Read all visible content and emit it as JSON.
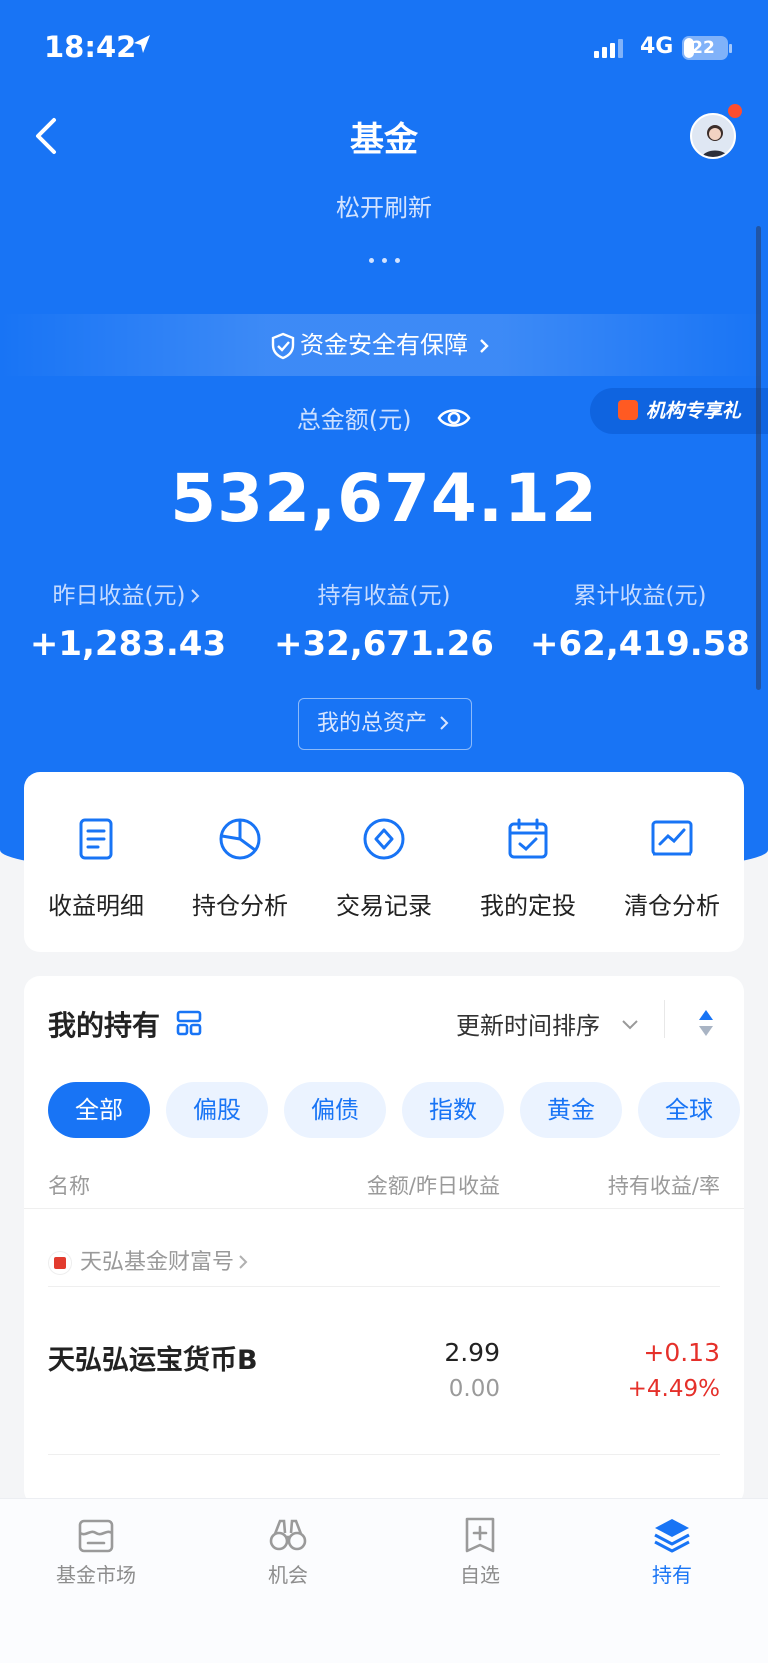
{
  "status_bar": {
    "time": "18:42",
    "network": "4G",
    "battery": "22"
  },
  "header": {
    "title": "基金"
  },
  "pull_refresh": {
    "text": "松开刷新"
  },
  "security": {
    "text": "资金安全有保障"
  },
  "promo": {
    "label": "机构专享礼"
  },
  "summary": {
    "total_label": "总金额(元)",
    "total_value": "532,674.12",
    "stats": [
      {
        "label": "昨日收益(元)",
        "value": "+1,283.43"
      },
      {
        "label": "持有收益(元)",
        "value": "+32,671.26"
      },
      {
        "label": "累计收益(元)",
        "value": "+62,419.58"
      }
    ],
    "assets_button": "我的总资产"
  },
  "quick_actions": [
    {
      "label": "收益明细",
      "icon": "document-icon"
    },
    {
      "label": "持仓分析",
      "icon": "pie-chart-icon"
    },
    {
      "label": "交易记录",
      "icon": "compass-icon"
    },
    {
      "label": "我的定投",
      "icon": "calendar-check-icon"
    },
    {
      "label": "清仓分析",
      "icon": "trend-chart-icon"
    }
  ],
  "holdings": {
    "title": "我的持有",
    "sort_label": "更新时间排序",
    "filters": [
      "全部",
      "偏股",
      "偏债",
      "指数",
      "黄金",
      "全球"
    ],
    "active_filter": "全部",
    "columns": {
      "name": "名称",
      "amount": "金额/昨日收益",
      "profit": "持有收益/率"
    },
    "company": "天弘基金财富号",
    "funds": [
      {
        "name": "天弘弘运宝货币B",
        "amount": "2.99",
        "yesterday": "0.00",
        "profit": "+0.13",
        "rate": "+4.49%"
      }
    ]
  },
  "tabbar": {
    "items": [
      {
        "label": "基金市场",
        "icon": "store-icon"
      },
      {
        "label": "机会",
        "icon": "binoculars-icon"
      },
      {
        "label": "自选",
        "icon": "add-bookmark-icon"
      },
      {
        "label": "持有",
        "icon": "layers-icon"
      }
    ],
    "active": "持有"
  },
  "colors": {
    "primary": "#1874f5",
    "profit_red": "#e5302a",
    "background": "#f4f5f7"
  }
}
